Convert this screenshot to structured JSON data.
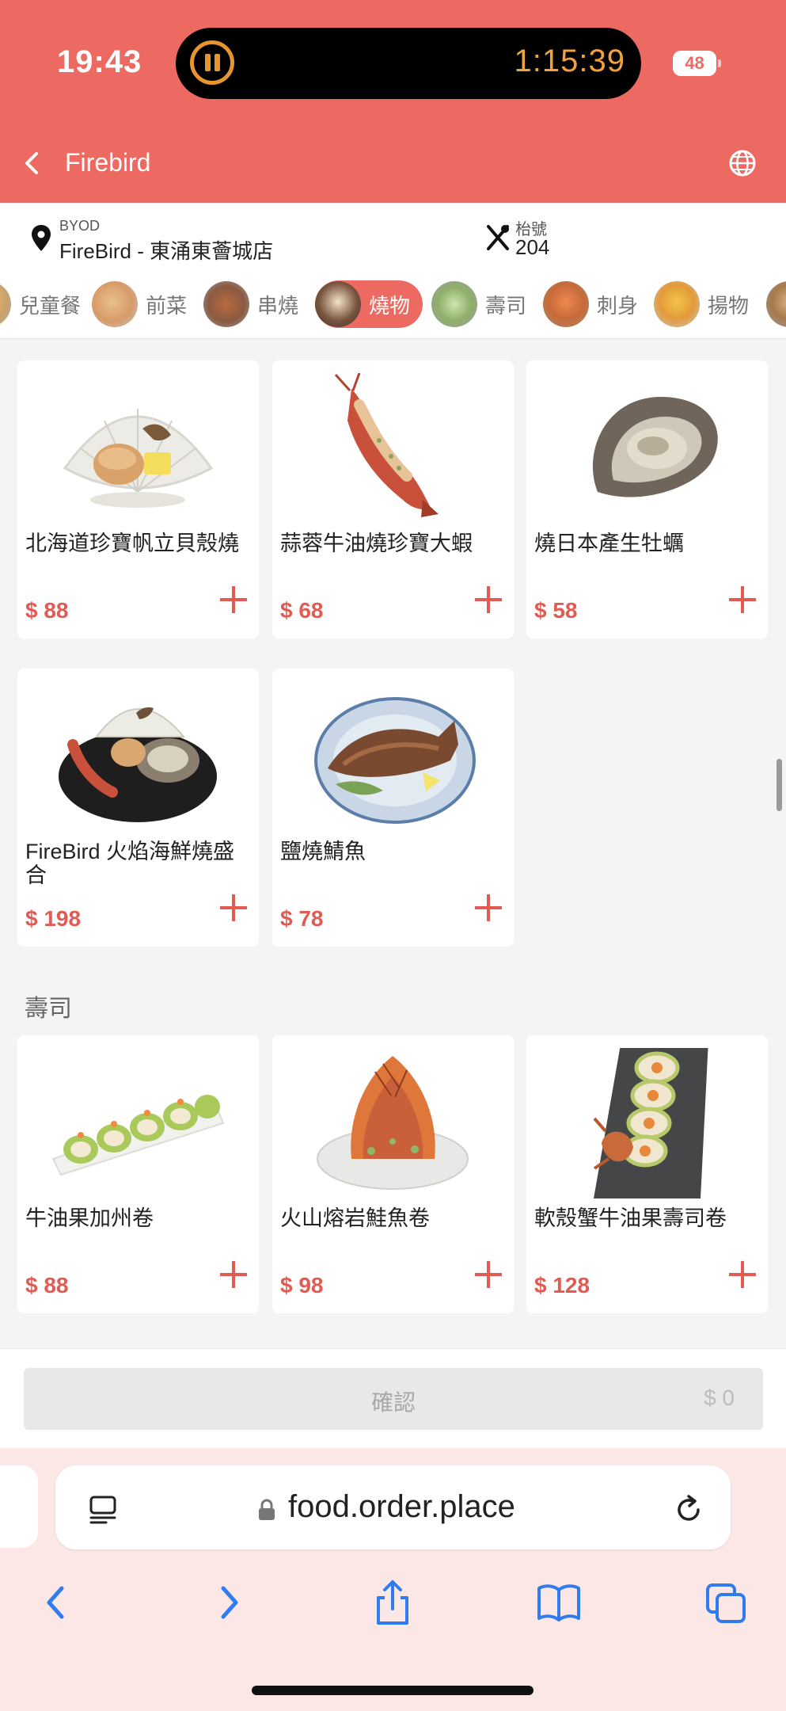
{
  "status": {
    "time": "19:43",
    "timer": "1:15:39",
    "battery": "48"
  },
  "nav": {
    "title": "Firebird"
  },
  "info": {
    "store_label": "BYOD",
    "store_name": "FireBird - 東涌東薈城店",
    "table_label": "枱號",
    "table_number": "204"
  },
  "categories": [
    {
      "label": "兒童餐"
    },
    {
      "label": "前菜"
    },
    {
      "label": "串燒"
    },
    {
      "label": "燒物",
      "active": true
    },
    {
      "label": "壽司"
    },
    {
      "label": "刺身"
    },
    {
      "label": "揚物"
    }
  ],
  "sections": [
    {
      "title": "",
      "items": [
        {
          "name": "北海道珍寶帆立貝殼燒",
          "price": "$ 88"
        },
        {
          "name": "蒜蓉牛油燒珍寶大蝦",
          "price": "$ 68"
        },
        {
          "name": "燒日本產生牡蠣",
          "price": "$ 58"
        },
        {
          "name": "FireBird 火焰海鮮燒盛合",
          "price": "$ 198"
        },
        {
          "name": "鹽燒鯖魚",
          "price": "$ 78"
        }
      ]
    },
    {
      "title": "壽司",
      "items": [
        {
          "name": "牛油果加州卷",
          "price": "$ 88"
        },
        {
          "name": "火山熔岩鮭魚卷",
          "price": "$ 98"
        },
        {
          "name": "軟殼蟹牛油果壽司卷",
          "price": "$ 128"
        }
      ]
    }
  ],
  "footer": {
    "confirm_label": "確認",
    "total": "$ 0"
  },
  "browser": {
    "url": "food.order.place"
  },
  "colors": {
    "accent": "#ec6a61",
    "price": "#e25b52"
  }
}
